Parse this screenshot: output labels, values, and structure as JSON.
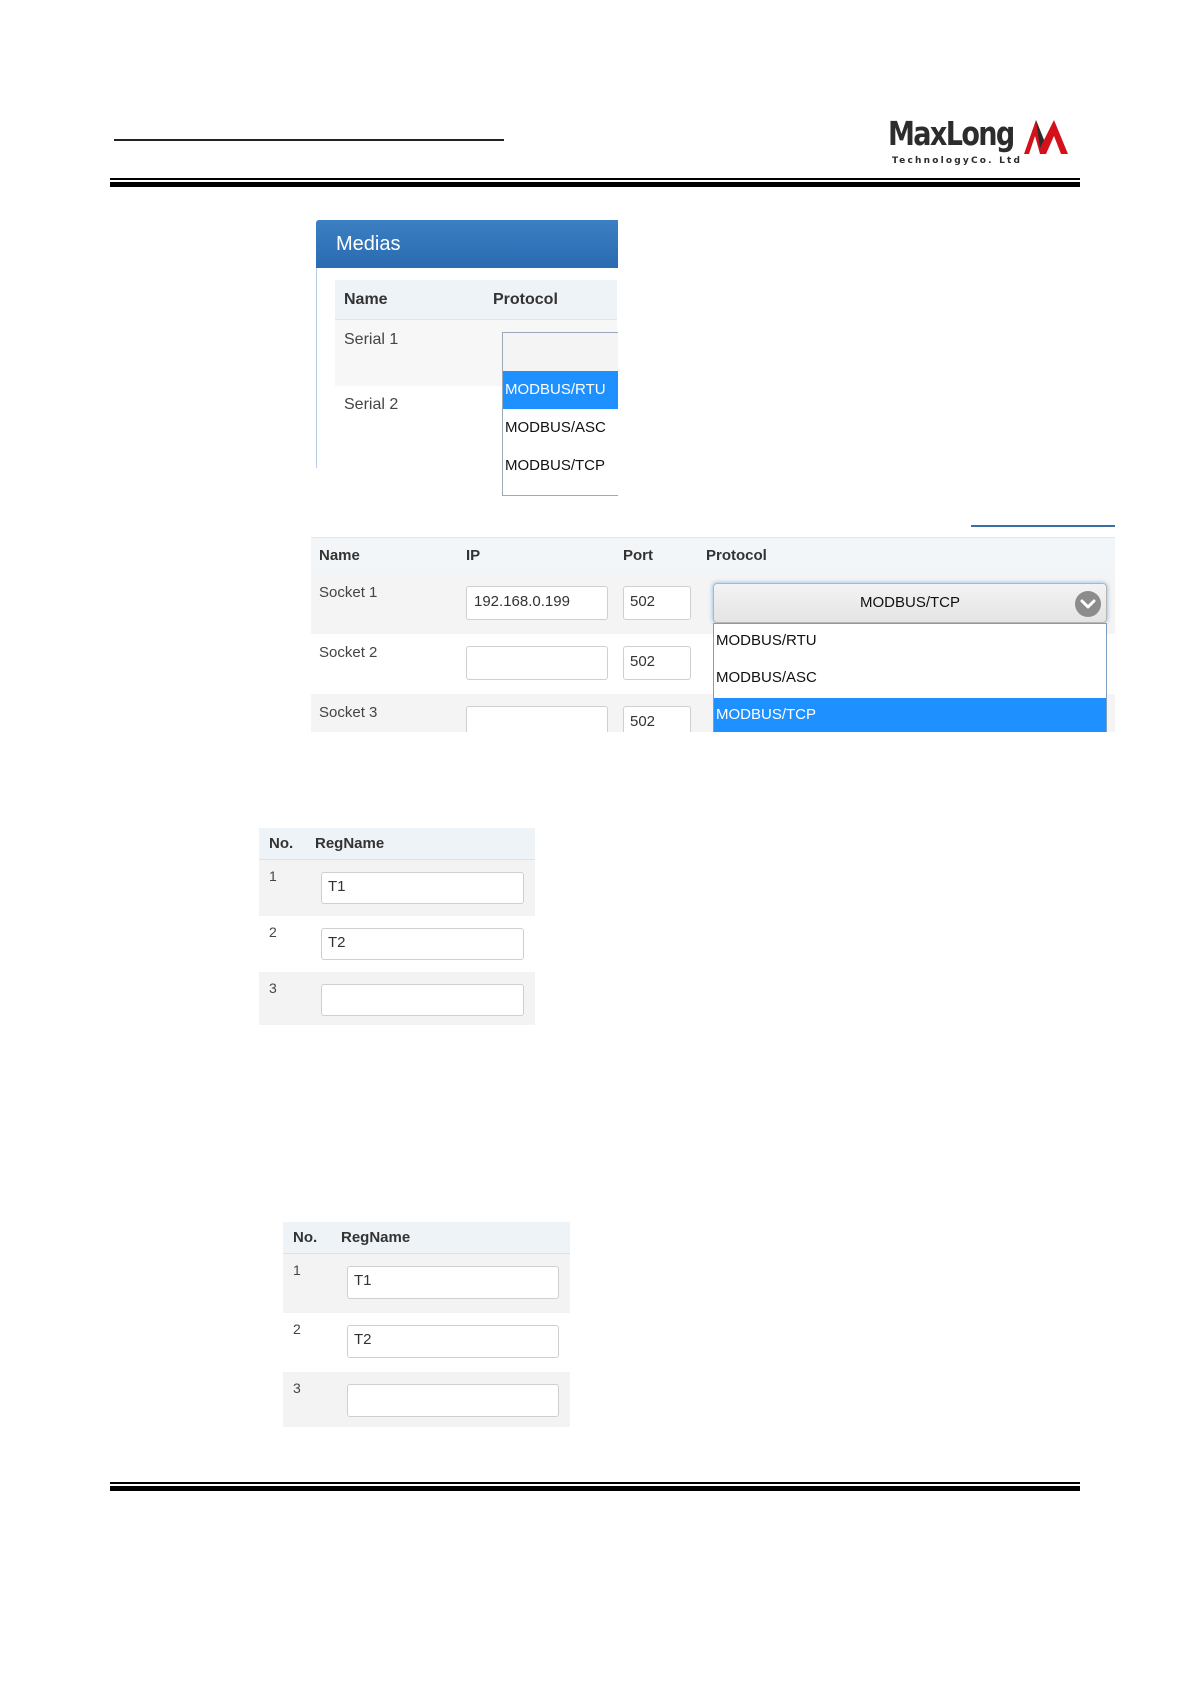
{
  "header": {
    "logo_text": "MaxLong",
    "logo_subtext": "TechnologyCo. Ltd"
  },
  "medias": {
    "title": "Medias",
    "columns": [
      "Name",
      "Protocol"
    ],
    "rows": [
      "Serial 1",
      "Serial 2"
    ],
    "dropdown": {
      "options": [
        "MODBUS/RTU",
        "MODBUS/ASC",
        "MODBUS/TCP"
      ],
      "highlighted": "MODBUS/RTU"
    }
  },
  "sockets": {
    "columns": [
      "Name",
      "IP",
      "Port",
      "Protocol"
    ],
    "rows": [
      {
        "name": "Socket 1",
        "ip": "192.168.0.199",
        "port": "502"
      },
      {
        "name": "Socket 2",
        "ip": "",
        "port": "502"
      },
      {
        "name": "Socket 3",
        "ip": "",
        "port": "502"
      }
    ],
    "protocol_selected": "MODBUS/TCP",
    "dropdown": {
      "options": [
        "MODBUS/RTU",
        "MODBUS/ASC",
        "MODBUS/TCP"
      ],
      "highlighted": "MODBUS/TCP"
    }
  },
  "reg_table_1": {
    "columns": [
      "No.",
      "RegName"
    ],
    "rows": [
      {
        "no": "1",
        "regname": "T1"
      },
      {
        "no": "2",
        "regname": "T2"
      },
      {
        "no": "3",
        "regname": ""
      }
    ]
  },
  "reg_table_2": {
    "columns": [
      "No.",
      "RegName"
    ],
    "rows": [
      {
        "no": "1",
        "regname": "T1"
      },
      {
        "no": "2",
        "regname": "T2"
      },
      {
        "no": "3",
        "regname": ""
      }
    ]
  },
  "colors": {
    "panel_header": "#2a6bb1",
    "selection": "#1e90ff",
    "logo_red": "#d4111b"
  }
}
